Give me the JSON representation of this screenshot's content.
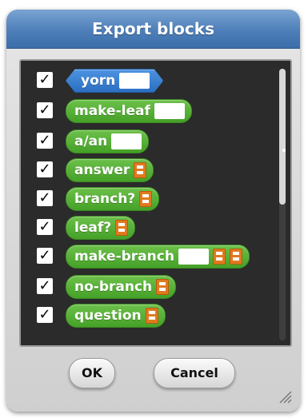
{
  "dialog": {
    "title": "Export blocks",
    "blocks": [
      {
        "label": "yorn",
        "checked": true,
        "style": "blue-reporter",
        "slots": [
          "text"
        ]
      },
      {
        "label": "make-leaf",
        "checked": true,
        "style": "green-reporter",
        "slots": [
          "text"
        ]
      },
      {
        "label": "a/an",
        "checked": true,
        "style": "green-reporter",
        "slots": [
          "text"
        ]
      },
      {
        "label": "answer",
        "checked": true,
        "style": "green-reporter",
        "slots": [
          "list"
        ]
      },
      {
        "label": "branch?",
        "checked": true,
        "style": "green-reporter",
        "slots": [
          "list"
        ]
      },
      {
        "label": "leaf?",
        "checked": true,
        "style": "green-reporter",
        "slots": [
          "list"
        ]
      },
      {
        "label": "make-branch",
        "checked": true,
        "style": "green-reporter",
        "slots": [
          "text",
          "list",
          "list"
        ]
      },
      {
        "label": "no-branch",
        "checked": true,
        "style": "green-reporter",
        "slots": [
          "list"
        ]
      },
      {
        "label": "question",
        "checked": true,
        "style": "green-reporter",
        "slots": [
          "list"
        ]
      }
    ],
    "checkmark": "✓",
    "ok_label": "OK",
    "cancel_label": "Cancel"
  },
  "colors": {
    "title_bar": "#4e7fb9",
    "list_background": "#2b2b2b",
    "block_green": "#45a127",
    "block_blue": "#2c6fc2",
    "list_slot_orange": "#e07a1f"
  },
  "icons": {
    "resize": "resize-grip-icon",
    "check": "checkmark-icon",
    "list_slot": "list-slot-icon"
  }
}
